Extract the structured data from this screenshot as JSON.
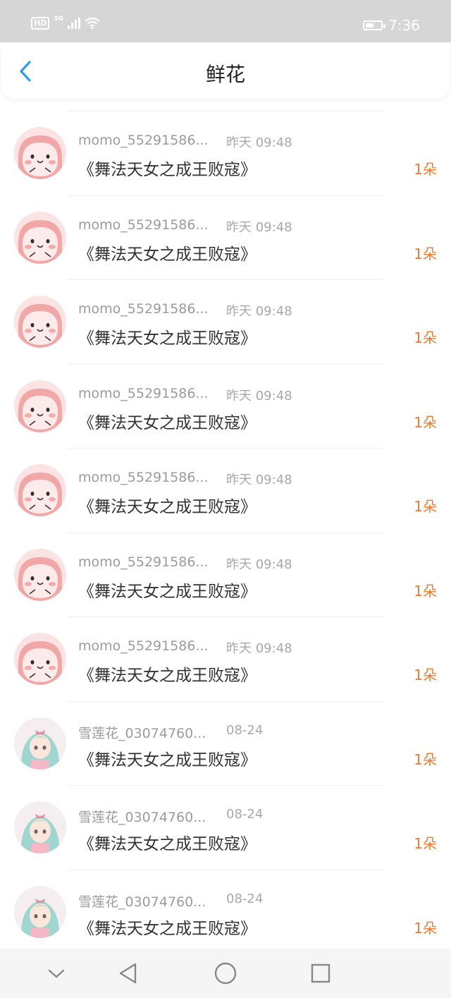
{
  "status_bar": {
    "hd": "HD",
    "network": "5G",
    "time": "7:36",
    "battery_level": 0.55
  },
  "header": {
    "title": "鲜花",
    "back_icon": "chevron-left-icon",
    "accent_color": "#2f9be8"
  },
  "list": {
    "count_color": "#f07a2b",
    "items": [
      {
        "user": "momo_55291586...",
        "date": "昨天 09:48",
        "title": "《舞法天女之成王败寇》",
        "count": "1朵",
        "avatar": "pink-blob-avatar"
      },
      {
        "user": "momo_55291586...",
        "date": "昨天 09:48",
        "title": "《舞法天女之成王败寇》",
        "count": "1朵",
        "avatar": "pink-blob-avatar"
      },
      {
        "user": "momo_55291586...",
        "date": "昨天 09:48",
        "title": "《舞法天女之成王败寇》",
        "count": "1朵",
        "avatar": "pink-blob-avatar"
      },
      {
        "user": "momo_55291586...",
        "date": "昨天 09:48",
        "title": "《舞法天女之成王败寇》",
        "count": "1朵",
        "avatar": "pink-blob-avatar"
      },
      {
        "user": "momo_55291586...",
        "date": "昨天 09:48",
        "title": "《舞法天女之成王败寇》",
        "count": "1朵",
        "avatar": "pink-blob-avatar"
      },
      {
        "user": "momo_55291586...",
        "date": "昨天 09:48",
        "title": "《舞法天女之成王败寇》",
        "count": "1朵",
        "avatar": "pink-blob-avatar"
      },
      {
        "user": "momo_55291586...",
        "date": "昨天 09:48",
        "title": "《舞法天女之成王败寇》",
        "count": "1朵",
        "avatar": "pink-blob-avatar"
      },
      {
        "user": "雪莲花_03074760...",
        "date": "08-24",
        "title": "《舞法天女之成王败寇》",
        "count": "1朵",
        "avatar": "anime-girl-avatar"
      },
      {
        "user": "雪莲花_03074760...",
        "date": "08-24",
        "title": "《舞法天女之成王败寇》",
        "count": "1朵",
        "avatar": "anime-girl-avatar"
      },
      {
        "user": "雪莲花_03074760...",
        "date": "08-24",
        "title": "《舞法天女之成王败寇》",
        "count": "1朵",
        "avatar": "anime-girl-avatar"
      }
    ]
  },
  "nav_bar": {
    "buttons": [
      "chevron-down-icon",
      "back-triangle-icon",
      "home-circle-icon",
      "recents-square-icon"
    ]
  }
}
